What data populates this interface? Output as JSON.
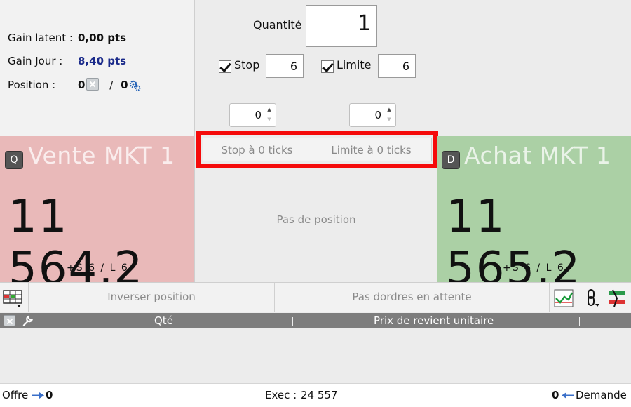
{
  "info": {
    "gain_latent_label": "Gain latent :",
    "gain_latent_value": "0,00 pts",
    "gain_jour_label": "Gain Jour :",
    "gain_jour_value": "8,40 pts",
    "position_label": "Position :",
    "position_value": "0",
    "position_sep": "/",
    "position_value2": "0"
  },
  "order": {
    "quantity_label": "Quantité",
    "quantity_value": "1",
    "stop_label": "Stop",
    "stop_checked": true,
    "stop_value": "6",
    "limit_label": "Limite",
    "limit_checked": true,
    "limit_value": "6",
    "spinner_left": "0",
    "spinner_right": "0"
  },
  "ticks": {
    "stop_label": "Stop à 0 ticks",
    "limit_label": "Limite à 0 ticks",
    "no_position": "Pas de position"
  },
  "sell": {
    "badge": "Q",
    "title": "Vente MKT 1",
    "price": "11 564,2",
    "sl": "+S 6 / L 6",
    "color": "#e9b9b9"
  },
  "buy": {
    "badge": "D",
    "title": "Achat MKT 1",
    "price": "11 565,2",
    "sl": "+S 6 / L 6",
    "color": "#abd0a5"
  },
  "actions": {
    "reverse": "Inverser position",
    "no_pending": "Pas dordres en attente"
  },
  "table": {
    "col_qty": "Qté",
    "col_price": "Prix de revient unitaire"
  },
  "status": {
    "offer_label": "Offre",
    "offer_value": "0",
    "exec_label": "Exec :",
    "exec_value": "24 557",
    "demand_value": "0",
    "demand_label": "Demande"
  },
  "colors": {
    "highlight_frame": "#f50b0b",
    "header_bar": "#7d7d7d",
    "gain_jour": "#1a2a8a"
  }
}
